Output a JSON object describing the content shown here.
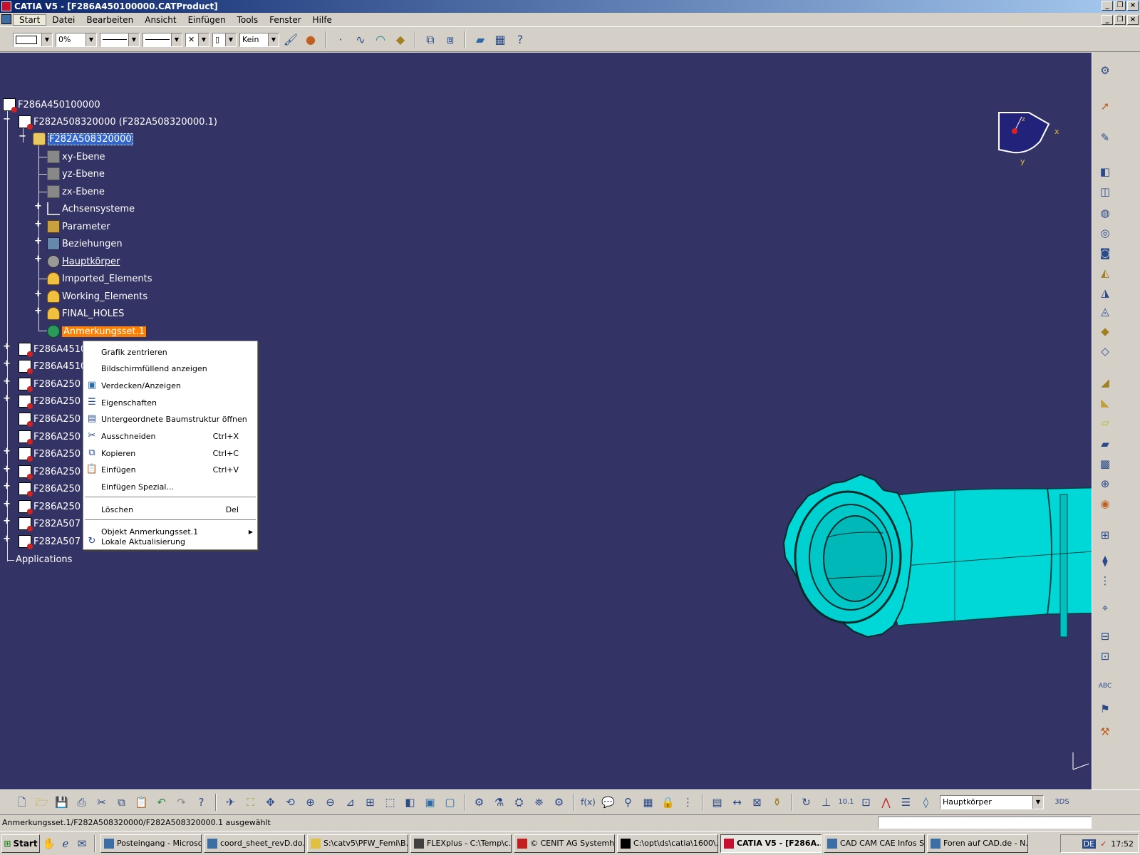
{
  "window": {
    "title": "CATIA V5 - [F286A450100000.CATProduct]"
  },
  "menubar": {
    "items": [
      "Start",
      "Datei",
      "Bearbeiten",
      "Ansicht",
      "Einfügen",
      "Tools",
      "Fenster",
      "Hilfe"
    ]
  },
  "toolbar_top": {
    "transparency_value": "0%",
    "layer_value": "Kein"
  },
  "tree": {
    "root": "F286A450100000",
    "child_product": "F282A508320000 (F282A508320000.1)",
    "part": "F282A508320000",
    "part_children": [
      "xy-Ebene",
      "yz-Ebene",
      "zx-Ebene",
      "Achsensysteme",
      "Parameter",
      "Beziehungen",
      "Hauptkörper",
      "Imported_Elements",
      "Working_Elements",
      "FINAL_HOLES",
      "Anmerkungsset.1"
    ],
    "siblings": [
      "F286A4510",
      "F286A4510",
      "F286A250",
      "F286A250",
      "F286A250",
      "F286A250",
      "F286A250",
      "F286A250",
      "F286A250",
      "F286A250",
      "F282A507",
      "F282A507"
    ],
    "applications": "Applications"
  },
  "context_menu": {
    "items": [
      {
        "label": "Grafik zentrieren",
        "shortcut": ""
      },
      {
        "label": "Bildschirmfüllend anzeigen",
        "shortcut": ""
      },
      {
        "label": "Verdecken/Anzeigen",
        "shortcut": ""
      },
      {
        "label": "Eigenschaften",
        "shortcut": ""
      },
      {
        "label": "Untergeordnete Baumstruktur öffnen",
        "shortcut": ""
      },
      {
        "label": "Ausschneiden",
        "shortcut": "Ctrl+X"
      },
      {
        "label": "Kopieren",
        "shortcut": "Ctrl+C"
      },
      {
        "label": "Einfügen",
        "shortcut": "Ctrl+V"
      },
      {
        "label": "Einfügen Spezial...",
        "shortcut": ""
      },
      {
        "label": "Löschen",
        "shortcut": "Del"
      },
      {
        "label": "Objekt Anmerkungsset.1",
        "shortcut": ""
      },
      {
        "label": "Lokale Aktualisierung",
        "shortcut": ""
      }
    ]
  },
  "compass": {
    "x_label": "x",
    "y_label": "y",
    "z_label": "z"
  },
  "toolbar_bottom": {
    "body_selector": "Hauptkörper"
  },
  "statusbar": {
    "message": "Anmerkungsset.1/F282A508320000/F282A508320000.1 ausgewählt"
  },
  "taskbar": {
    "start_label": "Start",
    "tasks": [
      "Posteingang - Microso...",
      "coord_sheet_revD.do...",
      "S:\\catv5\\PFW_Femi\\B...",
      "FLEXplus - C:\\Temp\\c...",
      "© CENIT AG Systemh...",
      "C:\\opt\\ds\\catia\\1600\\...",
      "CATIA V5 - [F286A...",
      "CAD CAM CAE Infos S...",
      "Foren auf CAD.de - N..."
    ],
    "active_task_index": 6,
    "language": "DE",
    "clock": "17:52"
  },
  "colors": {
    "viewport_bg": "#333366",
    "part_cyan": "#00d8d8",
    "selection_orange": "#ff8000",
    "selection_blue": "#3366cc"
  }
}
